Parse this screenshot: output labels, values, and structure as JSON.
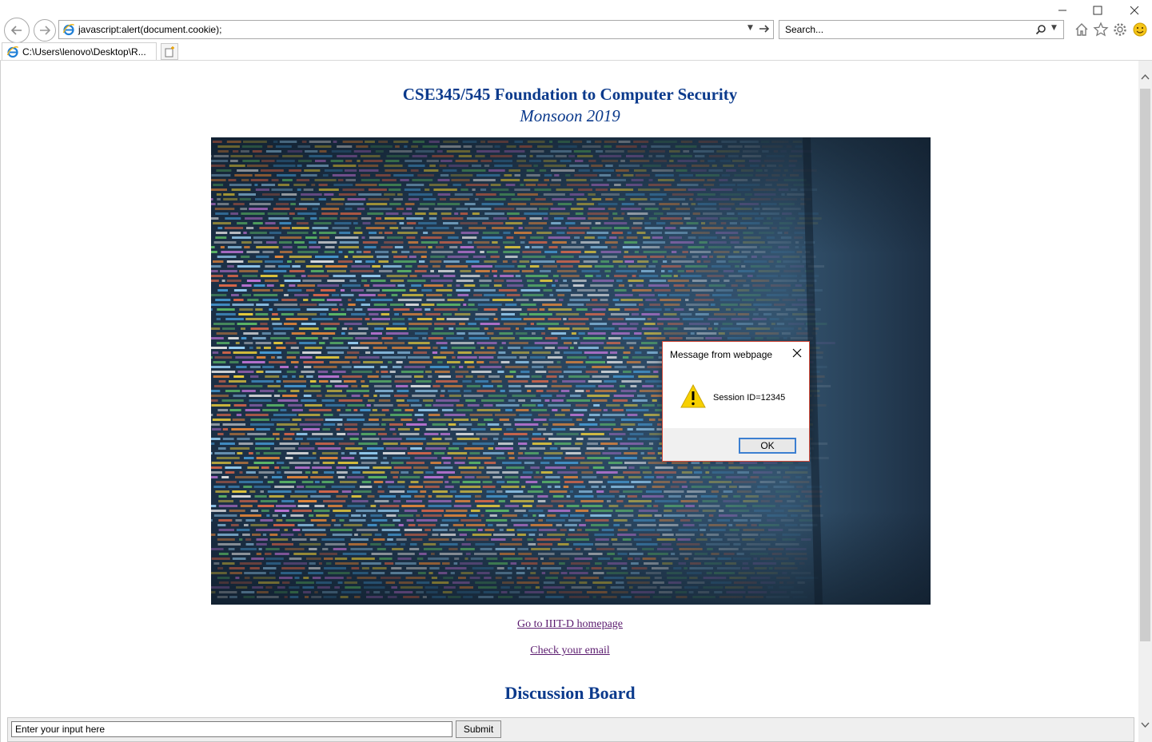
{
  "browser": {
    "address_url": "javascript:alert(document.cookie);",
    "search_placeholder": "Search...",
    "tab_title": "C:\\Users\\lenovo\\Desktop\\R..."
  },
  "page": {
    "title": "CSE345/545 Foundation to Computer Security",
    "subtitle": "Monsoon 2019",
    "links": {
      "homepage": "Go to IIIT-D homepage",
      "email": "Check your email"
    },
    "board_title": "Discussion Board",
    "form": {
      "input_placeholder": "Enter your input here",
      "submit_label": "Submit"
    }
  },
  "dialog": {
    "title": "Message from webpage",
    "message": "Session ID=12345",
    "ok_label": "OK"
  },
  "colors": {
    "heading": "#0b3a8c",
    "link": "#5a1a6e",
    "dialog_border": "#d34a3a",
    "ok_focus": "#3c7fd1"
  },
  "icons": [
    "back-arrow-icon",
    "forward-arrow-icon",
    "ie-logo-icon",
    "dropdown-icon",
    "go-arrow-icon",
    "search-icon",
    "home-icon",
    "favorites-star-icon",
    "settings-gear-icon",
    "smiley-feedback-icon",
    "minimize-icon",
    "maximize-icon",
    "close-icon",
    "new-tab-icon",
    "warning-icon"
  ]
}
